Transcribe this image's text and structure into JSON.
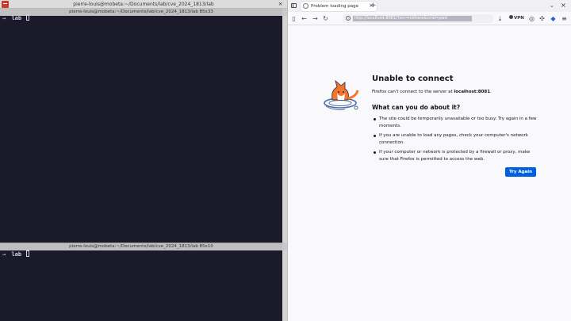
{
  "terminal": {
    "window_title": "pierre-louis@mobeta:~/Documents/lab/cve_2024_1813/lab",
    "top_pane": {
      "title": "pierre-louis@mobeta:~/Documents/lab/cve_2024_1813/lab 85x33",
      "prompt_arrow": "→",
      "prompt_dir": "lab"
    },
    "bottom_pane": {
      "title": "pierre-louis@mobeta:~/Documents/lab/cve_2024_1813/lab 85x10",
      "prompt_arrow": "→",
      "prompt_dir": "lab"
    },
    "close_icon": "×",
    "colors": {
      "background": "#1b1a2b",
      "text": "#d6d6e0",
      "app_icon": "#cc3a2a"
    }
  },
  "browser": {
    "tab": {
      "label": "Problem loading page",
      "close": "×"
    },
    "new_tab": "+",
    "url": "http://localhost:8081/?src=nothere&cmd=pwd",
    "vpn_label": "VPN",
    "icons": [
      "sidebar-icon",
      "back-icon",
      "forward-icon",
      "reload-icon",
      "info-icon",
      "download-icon",
      "account-icon",
      "extensions-icon",
      "bookmark-icon",
      "menu-icon"
    ],
    "error": {
      "title": "Unable to connect",
      "description_prefix": "Firefox can't connect to the server at ",
      "host": "localhost:8081",
      "description_suffix": ".",
      "subtitle": "What can you do about it?",
      "items": [
        "The site could be temporarily unavailable or too busy. Try again in a few moments.",
        "If you are unable to load any pages, check your computer's network connection.",
        "If your computer or network is protected by a firewall or proxy, make sure that Firefox is permitted to access the web."
      ],
      "button": "Try Again"
    },
    "colors": {
      "accent": "#0061e0",
      "page_bg": "#f9f9fb",
      "fox_orange": "#f27630",
      "fox_blue": "#4a6fa5"
    }
  }
}
